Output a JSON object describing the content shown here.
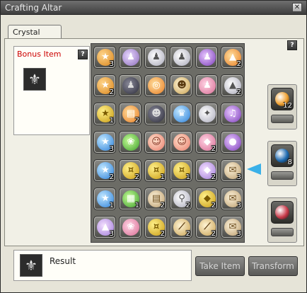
{
  "window": {
    "title": "Crafting Altar",
    "close_label": "✕"
  },
  "tab": {
    "label": "Crystal Altar"
  },
  "bonus": {
    "title": "Bonus Item",
    "help_label": "?",
    "slot_symbol": "⚜"
  },
  "grid_help_label": "?",
  "result": {
    "label": "Result",
    "slot_symbol": "⚜"
  },
  "buttons": {
    "take_item": "Take Item",
    "transform": "Transform"
  },
  "side_slots": [
    {
      "name": "orange-coin",
      "count": "12"
    },
    {
      "name": "blue-gem",
      "count": "8"
    },
    {
      "name": "red-gem",
      "count": ""
    }
  ],
  "grid": [
    [
      {
        "icon": "orange-coin",
        "g": "★",
        "count": "3"
      },
      {
        "icon": "purple-outfit",
        "g": "♟",
        "count": ""
      },
      {
        "icon": "white-outfit",
        "g": "♟",
        "count": ""
      },
      {
        "icon": "white-outfit",
        "g": "♟",
        "count": ""
      },
      {
        "icon": "purple-dress",
        "g": "♟",
        "count": ""
      },
      {
        "icon": "orange-crystal",
        "g": "▲",
        "count": "2"
      }
    ],
    [
      {
        "icon": "orange-coin",
        "g": "★",
        "count": "2"
      },
      {
        "icon": "dark-outfit",
        "g": "♟",
        "count": ""
      },
      {
        "icon": "orange-swirl",
        "g": "◎",
        "count": ""
      },
      {
        "icon": "teddy-bear",
        "g": "☻",
        "count": ""
      },
      {
        "icon": "pink-outfit",
        "g": "♟",
        "count": ""
      },
      {
        "icon": "white-crystal",
        "g": "▲",
        "count": "2"
      }
    ],
    [
      {
        "icon": "orange-coin",
        "g": "★",
        "count": "1"
      },
      {
        "icon": "orange-book",
        "g": "▤",
        "count": "2"
      },
      {
        "icon": "cat-mask",
        "g": "☻",
        "count": ""
      },
      {
        "icon": "blue-hat",
        "g": "♛",
        "count": ""
      },
      {
        "icon": "white-wing",
        "g": "✦",
        "count": ""
      },
      {
        "icon": "purple-note",
        "g": "♫",
        "count": ""
      }
    ],
    [
      {
        "icon": "blue-coin",
        "g": "★",
        "count": "3"
      },
      {
        "icon": "green-bag",
        "g": "❀",
        "count": ""
      },
      {
        "icon": "pink-face",
        "g": "☺",
        "count": ""
      },
      {
        "icon": "pink-face",
        "g": "☺",
        "count": ""
      },
      {
        "icon": "pink-crystal",
        "g": "◆",
        "count": "2"
      },
      {
        "icon": "purple-gem",
        "g": "●",
        "count": ""
      }
    ],
    [
      {
        "icon": "blue-coin",
        "g": "★",
        "count": "2"
      },
      {
        "icon": "gold-coin",
        "g": "¤",
        "count": "2"
      },
      {
        "icon": "gold-coin",
        "g": "¤",
        "count": "1"
      },
      {
        "icon": "gold-coin",
        "g": "¤",
        "count": "1"
      },
      {
        "icon": "lilac-crystal",
        "g": "◆",
        "count": "2"
      },
      {
        "icon": "scroll",
        "g": "✉",
        "count": "3"
      }
    ],
    [
      {
        "icon": "blue-coin",
        "g": "★",
        "count": "1"
      },
      {
        "icon": "map-scroll",
        "g": "▦",
        "count": "1"
      },
      {
        "icon": "paper-scroll",
        "g": "▤",
        "count": "2"
      },
      {
        "icon": "spoon",
        "g": "⚲",
        "count": "2"
      },
      {
        "icon": "yellow-crystal",
        "g": "◆",
        "count": "2"
      },
      {
        "icon": "scroll",
        "g": "✉",
        "count": "3"
      }
    ],
    [
      {
        "icon": "purple-crystal",
        "g": "▲",
        "count": "3"
      },
      {
        "icon": "pink-flower",
        "g": "❀",
        "count": ""
      },
      {
        "icon": "gold-coin",
        "g": "¤",
        "count": "2"
      },
      {
        "icon": "wand",
        "g": "⟋",
        "count": "2"
      },
      {
        "icon": "wand",
        "g": "⟋",
        "count": "2"
      },
      {
        "icon": "scroll",
        "g": "✉",
        "count": "3"
      }
    ]
  ],
  "grid_styles": [
    [
      "g-coin-o",
      "g-cloth",
      "g-white",
      "g-white",
      "g-purple",
      "g-orange"
    ],
    [
      "g-coin-o",
      "g-dark",
      "g-orange",
      "g-wand",
      "g-pink",
      "g-white"
    ],
    [
      "g-coin-y",
      "g-orange",
      "g-dark",
      "g-coin-b",
      "g-white",
      "g-purple"
    ],
    [
      "g-coin-b",
      "g-green",
      "g-face",
      "g-face",
      "g-pink",
      "g-purple"
    ],
    [
      "g-coin-b",
      "g-coin-y",
      "g-coin-y",
      "g-coin-y",
      "g-crystal",
      "g-scroll"
    ],
    [
      "g-coin-b",
      "g-green",
      "g-scroll",
      "g-white",
      "g-coin-y",
      "g-scroll"
    ],
    [
      "g-crystal",
      "g-pink",
      "g-coin-y",
      "g-wand",
      "g-wand",
      "g-scroll"
    ]
  ],
  "colors": {
    "pointer": "#3ab0e8",
    "bonus_title": "#cc0000",
    "side_orbs": [
      "#f0a030",
      "#1e6ab0",
      "#c83a4a"
    ]
  }
}
